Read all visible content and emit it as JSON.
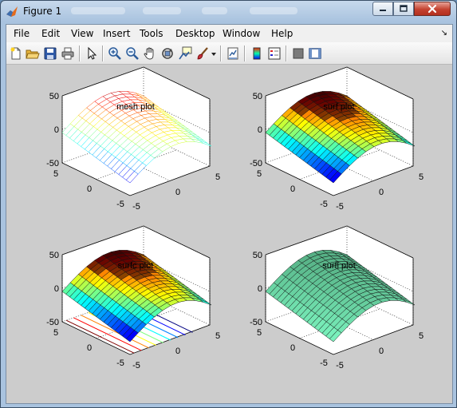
{
  "window": {
    "title": "Figure 1"
  },
  "menubar": {
    "items": [
      {
        "id": "file",
        "label": "File"
      },
      {
        "id": "edit",
        "label": "Edit"
      },
      {
        "id": "view",
        "label": "View"
      },
      {
        "id": "insert",
        "label": "Insert"
      },
      {
        "id": "tools",
        "label": "Tools"
      },
      {
        "id": "desktop",
        "label": "Desktop"
      },
      {
        "id": "window",
        "label": "Window"
      },
      {
        "id": "help",
        "label": "Help"
      }
    ]
  },
  "toolbar": {
    "icons": [
      "new-figure-icon",
      "open-file-icon",
      "save-icon",
      "print-icon",
      "edit-plot-icon",
      "zoom-in-icon",
      "zoom-out-icon",
      "pan-icon",
      "rotate-3d-icon",
      "data-cursor-icon",
      "brush-icon",
      "brush-dropdown-icon",
      "link-plot-icon",
      "insert-colorbar-icon",
      "insert-legend-icon",
      "hide-plot-tools-icon",
      "show-plot-tools-icon"
    ]
  },
  "colors": {
    "figure_bg": "#cccccc",
    "axes_bg": "#ffffff",
    "accent_titlebar": "#a9c3df",
    "close_button": "#c4412f"
  },
  "subplots": [
    {
      "id": "mesh",
      "title": "mesh plot",
      "style": "mesh"
    },
    {
      "id": "surf",
      "title": "surf plot",
      "style": "surf"
    },
    {
      "id": "surfc",
      "title": "surfc plot",
      "style": "surfc"
    },
    {
      "id": "surfl",
      "title": "surfl plot",
      "style": "surfl"
    }
  ],
  "axes": {
    "z_ticks": [
      "50",
      "0",
      "-50"
    ],
    "y_ticks": [
      "5",
      "0",
      "-5"
    ],
    "x_ticks": [
      "-5",
      "0",
      "5"
    ]
  }
}
